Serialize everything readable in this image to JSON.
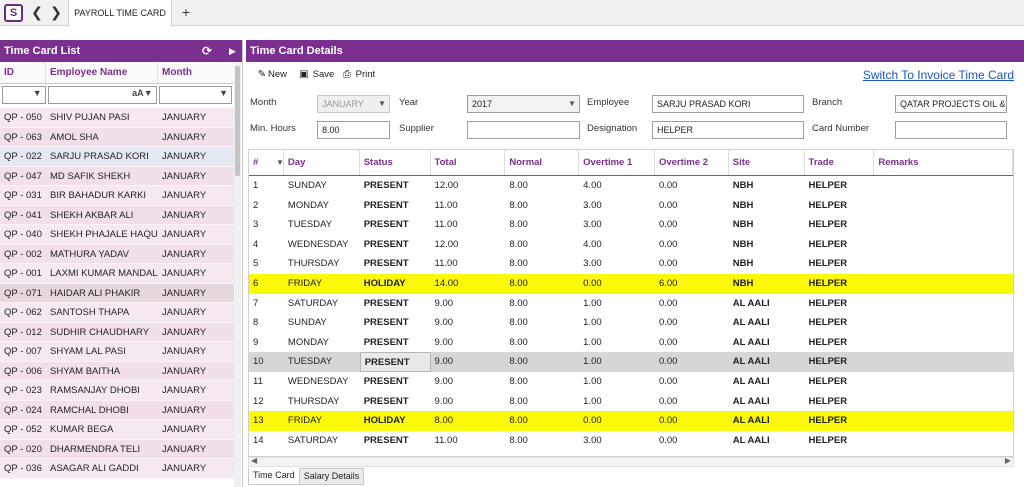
{
  "app": {
    "logo_text": "S",
    "tab_title": "PAYROLL TIME CARD"
  },
  "colors": {
    "accent": "#7b2f8e",
    "holiday": "#fbf80a",
    "link": "#1a56c8"
  },
  "left_panel": {
    "title": "Time Card List",
    "columns": [
      "ID",
      "Employee Name",
      "Month"
    ],
    "filter": {
      "name_case_symbol": "aA"
    },
    "rows": [
      {
        "id": "QP - 050",
        "name": "SHIV  PUJAN PASI",
        "month": "JANUARY"
      },
      {
        "id": "QP - 063",
        "name": "AMOL SHA",
        "month": "JANUARY"
      },
      {
        "id": "QP - 022",
        "name": "SARJU  PRASAD KORI",
        "month": "JANUARY"
      },
      {
        "id": "QP - 047",
        "name": "MD  SAFIK SHEKH",
        "month": "JANUARY"
      },
      {
        "id": "QP - 031",
        "name": "BIR BAHADUR KARKI",
        "month": "JANUARY"
      },
      {
        "id": "QP - 041",
        "name": "SHEKH  AKBAR ALI",
        "month": "JANUARY"
      },
      {
        "id": "QP - 040",
        "name": "SHEKH  PHAJALE HAQUE",
        "month": "JANUARY"
      },
      {
        "id": "QP - 002",
        "name": "MATHURA  YADAV",
        "month": "JANUARY"
      },
      {
        "id": "QP - 001",
        "name": "LAXMI  KUMAR MANDAL",
        "month": "JANUARY"
      },
      {
        "id": "QP - 071",
        "name": "HAIDAR  ALI PHAKIR",
        "month": "JANUARY"
      },
      {
        "id": "QP - 062",
        "name": "SANTOSH THAPA",
        "month": "JANUARY"
      },
      {
        "id": "QP - 012",
        "name": "SUDHIR  CHAUDHARY",
        "month": "JANUARY"
      },
      {
        "id": "QP - 007",
        "name": "SHYAM  LAL PASI",
        "month": "JANUARY"
      },
      {
        "id": "QP - 006",
        "name": "SHYAM  BAITHA",
        "month": "JANUARY"
      },
      {
        "id": "QP - 023",
        "name": "RAMSANJAY  DHOBI",
        "month": "JANUARY"
      },
      {
        "id": "QP - 024",
        "name": "RAMCHAL  DHOBI",
        "month": "JANUARY"
      },
      {
        "id": "QP - 052",
        "name": "KUMAR  BEGA",
        "month": "JANUARY"
      },
      {
        "id": "QP - 020",
        "name": "DHARMENDRA TELI",
        "month": "JANUARY"
      },
      {
        "id": "QP - 036",
        "name": "ASAGAR  ALI GADDI",
        "month": "JANUARY"
      }
    ]
  },
  "right_panel": {
    "title": "Time Card Details",
    "toolbar": {
      "new": "New",
      "save": "Save",
      "print": "Print",
      "switch_link": "Switch To Invoice Time Card"
    },
    "form": {
      "month_label": "Month",
      "month_value": "JANUARY",
      "year_label": "Year",
      "year_value": "2017",
      "employee_label": "Employee",
      "employee_value": "SARJU  PRASAD KORI",
      "branch_label": "Branch",
      "branch_value": "QATAR PROJECTS OIL & GAS",
      "minhours_label": "Min. Hours",
      "minhours_value": "8.00",
      "supplier_label": "Supplier",
      "supplier_value": "",
      "designation_label": "Designation",
      "designation_value": "HELPER",
      "cardnumber_label": "Card Number",
      "cardnumber_value": ""
    },
    "grid": {
      "columns": [
        "#",
        "Day",
        "Status",
        "Total",
        "Normal",
        "Overtime 1",
        "Overtime 2",
        "Site",
        "Trade",
        "Remarks"
      ],
      "rows": [
        {
          "n": "1",
          "day": "SUNDAY",
          "status": "PRESENT",
          "total": "12.00",
          "normal": "8.00",
          "ot1": "4.00",
          "ot2": "0.00",
          "site": "NBH",
          "trade": "HELPER",
          "remarks": ""
        },
        {
          "n": "2",
          "day": "MONDAY",
          "status": "PRESENT",
          "total": "11.00",
          "normal": "8.00",
          "ot1": "3.00",
          "ot2": "0.00",
          "site": "NBH",
          "trade": "HELPER",
          "remarks": ""
        },
        {
          "n": "3",
          "day": "TUESDAY",
          "status": "PRESENT",
          "total": "11.00",
          "normal": "8.00",
          "ot1": "3.00",
          "ot2": "0.00",
          "site": "NBH",
          "trade": "HELPER",
          "remarks": ""
        },
        {
          "n": "4",
          "day": "WEDNESDAY",
          "status": "PRESENT",
          "total": "12.00",
          "normal": "8.00",
          "ot1": "4.00",
          "ot2": "0.00",
          "site": "NBH",
          "trade": "HELPER",
          "remarks": ""
        },
        {
          "n": "5",
          "day": "THURSDAY",
          "status": "PRESENT",
          "total": "11.00",
          "normal": "8.00",
          "ot1": "3.00",
          "ot2": "0.00",
          "site": "NBH",
          "trade": "HELPER",
          "remarks": ""
        },
        {
          "n": "6",
          "day": "FRIDAY",
          "status": "HOLIDAY",
          "total": "14.00",
          "normal": "8.00",
          "ot1": "0.00",
          "ot2": "6.00",
          "site": "NBH",
          "trade": "HELPER",
          "remarks": ""
        },
        {
          "n": "7",
          "day": "SATURDAY",
          "status": "PRESENT",
          "total": "9.00",
          "normal": "8.00",
          "ot1": "1.00",
          "ot2": "0.00",
          "site": "AL AALI",
          "trade": "HELPER",
          "remarks": ""
        },
        {
          "n": "8",
          "day": "SUNDAY",
          "status": "PRESENT",
          "total": "9.00",
          "normal": "8.00",
          "ot1": "1.00",
          "ot2": "0.00",
          "site": "AL AALI",
          "trade": "HELPER",
          "remarks": ""
        },
        {
          "n": "9",
          "day": "MONDAY",
          "status": "PRESENT",
          "total": "9.00",
          "normal": "8.00",
          "ot1": "1.00",
          "ot2": "0.00",
          "site": "AL AALI",
          "trade": "HELPER",
          "remarks": ""
        },
        {
          "n": "10",
          "day": "TUESDAY",
          "status": "PRESENT",
          "total": "9.00",
          "normal": "8.00",
          "ot1": "1.00",
          "ot2": "0.00",
          "site": "AL AALI",
          "trade": "HELPER",
          "remarks": ""
        },
        {
          "n": "11",
          "day": "WEDNESDAY",
          "status": "PRESENT",
          "total": "9.00",
          "normal": "8.00",
          "ot1": "1.00",
          "ot2": "0.00",
          "site": "AL AALI",
          "trade": "HELPER",
          "remarks": ""
        },
        {
          "n": "12",
          "day": "THURSDAY",
          "status": "PRESENT",
          "total": "9.00",
          "normal": "8.00",
          "ot1": "1.00",
          "ot2": "0.00",
          "site": "AL AALI",
          "trade": "HELPER",
          "remarks": ""
        },
        {
          "n": "13",
          "day": "FRIDAY",
          "status": "HOLIDAY",
          "total": "8.00",
          "normal": "8.00",
          "ot1": "0.00",
          "ot2": "0.00",
          "site": "AL AALI",
          "trade": "HELPER",
          "remarks": ""
        },
        {
          "n": "14",
          "day": "SATURDAY",
          "status": "PRESENT",
          "total": "11.00",
          "normal": "8.00",
          "ot1": "3.00",
          "ot2": "0.00",
          "site": "AL AALI",
          "trade": "HELPER",
          "remarks": ""
        }
      ]
    },
    "bottom_tabs": [
      "Time Card",
      "Salary Details"
    ]
  }
}
